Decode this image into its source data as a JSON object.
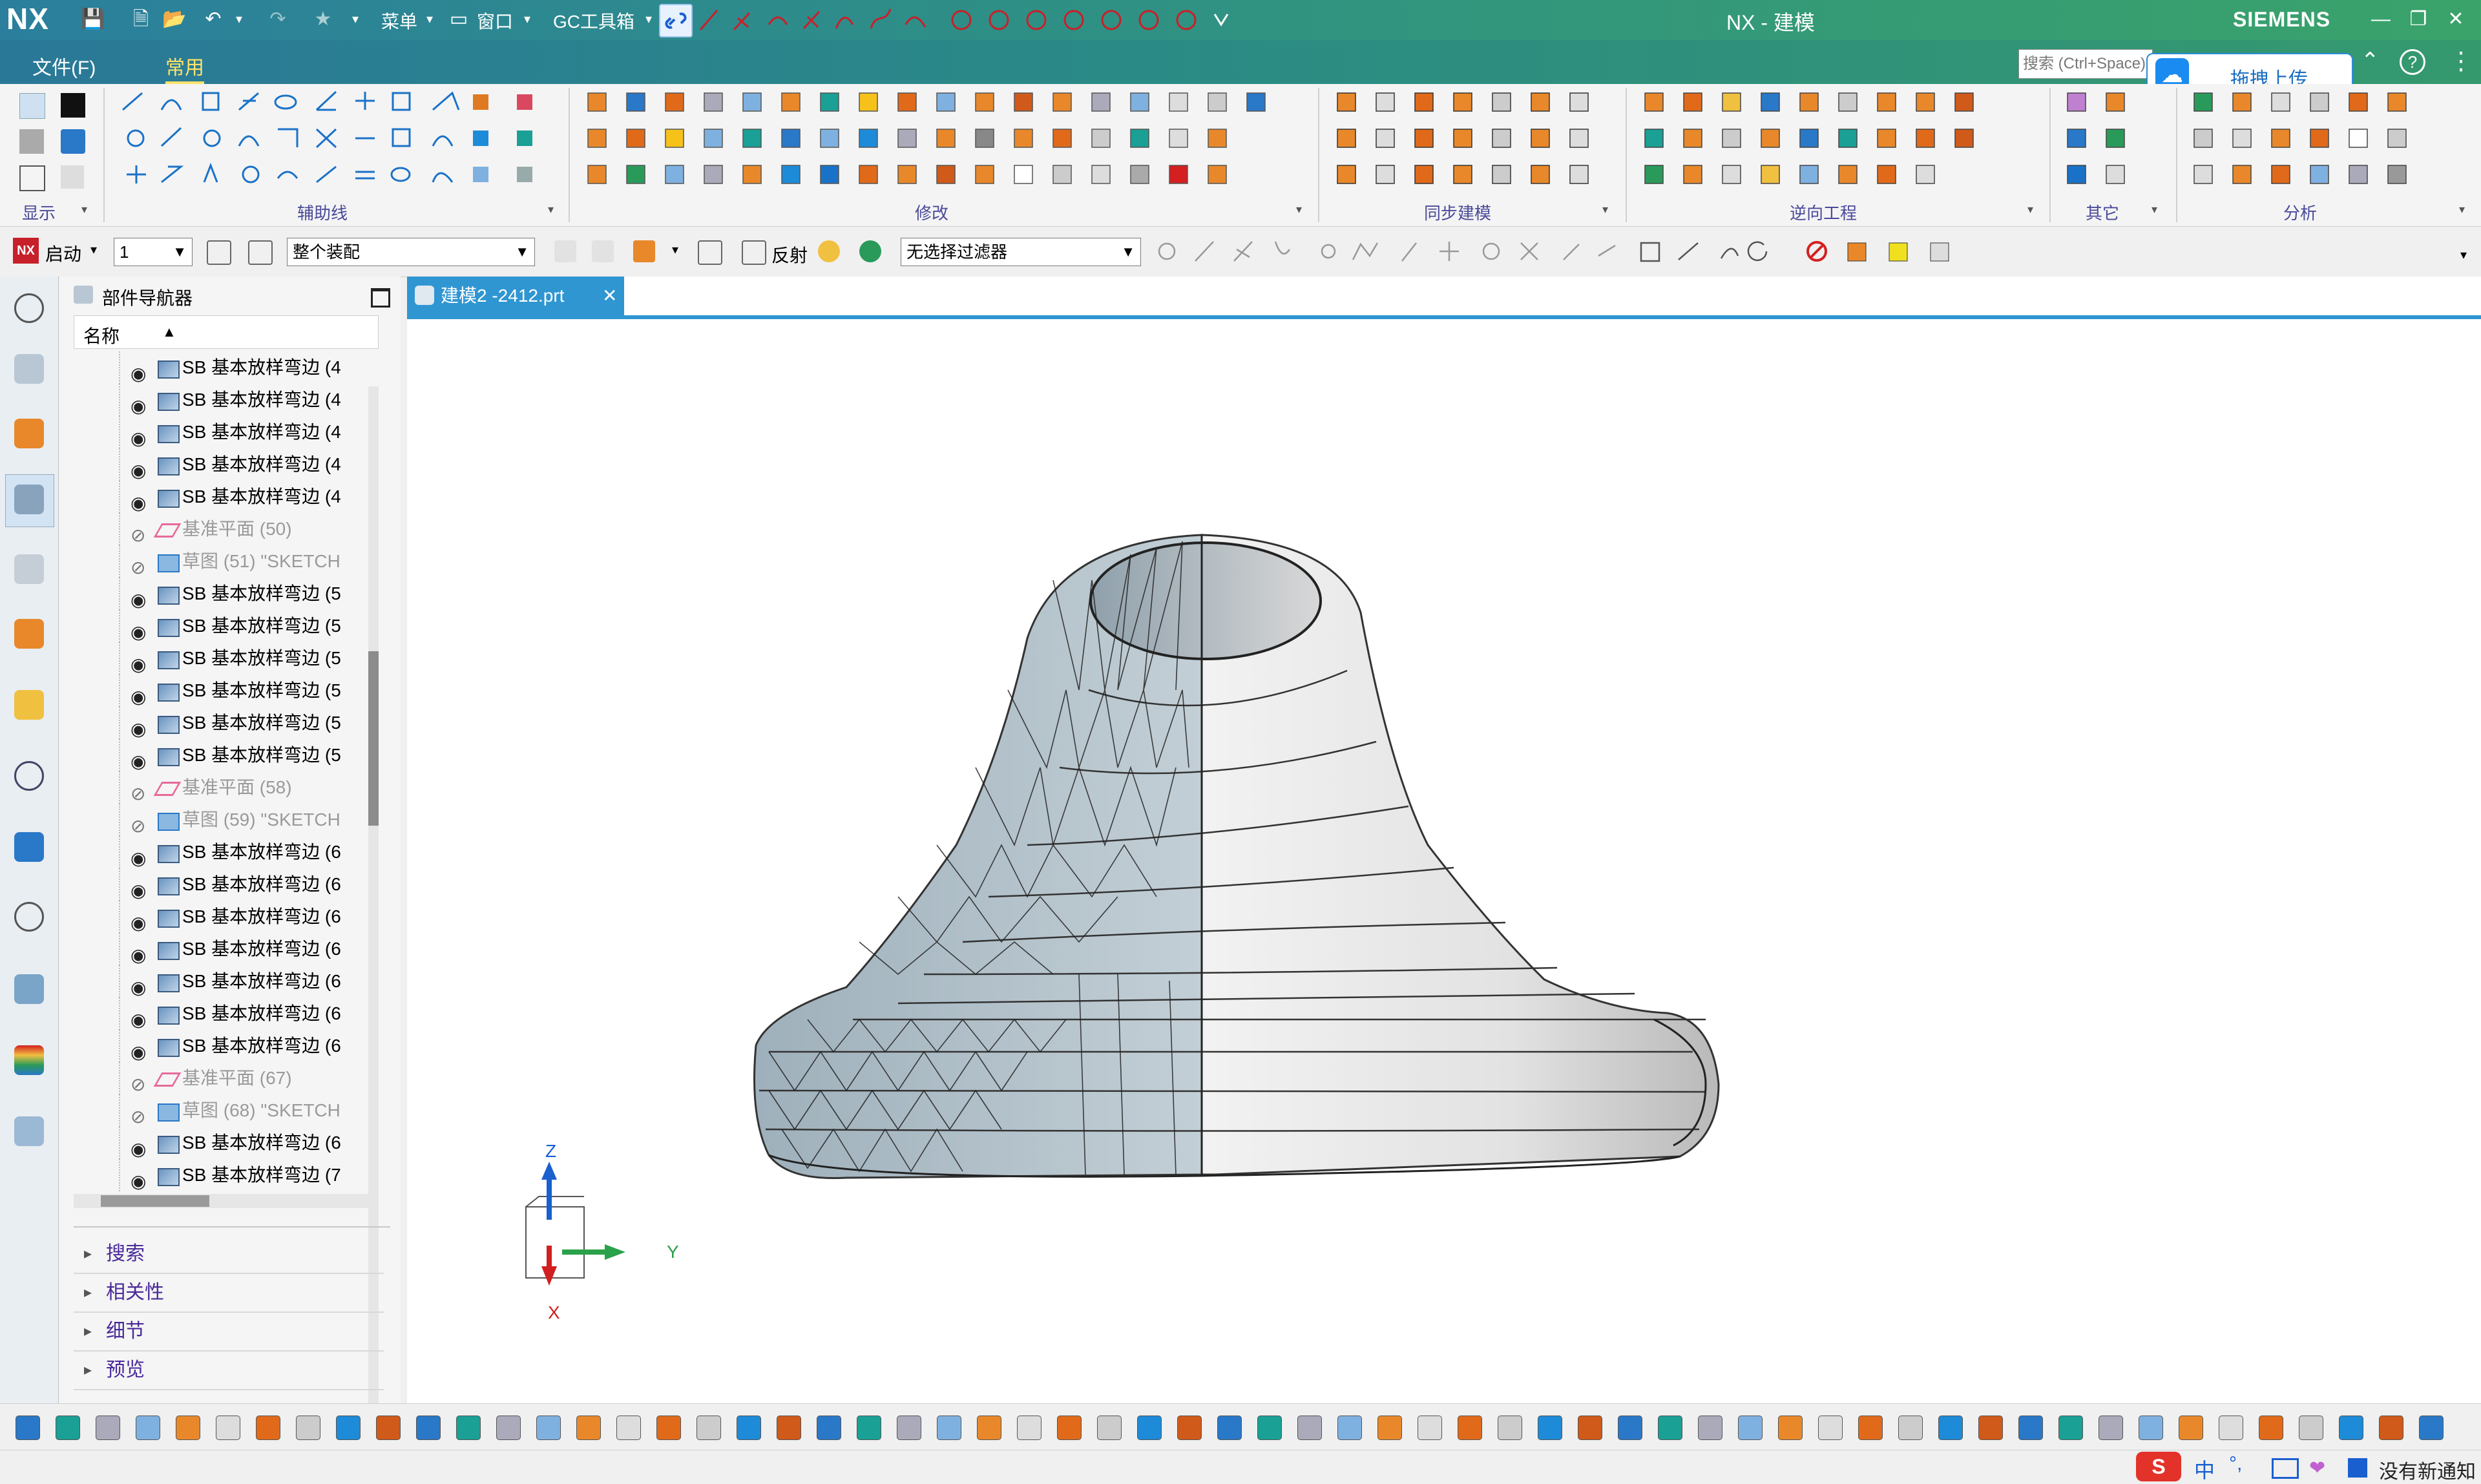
{
  "window": {
    "logo": "NX",
    "title": "NX - 建模",
    "brand": "SIEMENS",
    "quick_access": {
      "menu_label": "菜单",
      "window_label": "窗口",
      "gc_label": "GC工具箱"
    }
  },
  "menu": {
    "file_tab": "文件(F)",
    "home_tab": "常用",
    "search_placeholder": "搜索 (Ctrl+Space)",
    "upload_button": "拖拽上传"
  },
  "ribbon": {
    "groups": [
      "显示",
      "辅助线",
      "修改",
      "同步建模",
      "逆向工程",
      "其它",
      "分析"
    ]
  },
  "selection_bar": {
    "start_label": "启动",
    "layer_value": "1",
    "scope_value": "整个装配",
    "reverse_label": "反射",
    "filter_value": "无选择过滤器"
  },
  "navigator": {
    "title": "部件导航器",
    "column_name": "名称",
    "rows": [
      {
        "label": "SB 基本放样弯边 (4",
        "hidden": false,
        "kind": "flange"
      },
      {
        "label": "SB 基本放样弯边 (4",
        "hidden": false,
        "kind": "flange"
      },
      {
        "label": "SB 基本放样弯边 (4",
        "hidden": false,
        "kind": "flange"
      },
      {
        "label": "SB 基本放样弯边 (4",
        "hidden": false,
        "kind": "flange"
      },
      {
        "label": "SB 基本放样弯边 (4",
        "hidden": false,
        "kind": "flange"
      },
      {
        "label": "基准平面 (50)",
        "hidden": true,
        "kind": "plane"
      },
      {
        "label": "草图 (51) \"SKETCH",
        "hidden": true,
        "kind": "sketch"
      },
      {
        "label": "SB 基本放样弯边 (5",
        "hidden": false,
        "kind": "flange"
      },
      {
        "label": "SB 基本放样弯边 (5",
        "hidden": false,
        "kind": "flange"
      },
      {
        "label": "SB 基本放样弯边 (5",
        "hidden": false,
        "kind": "flange"
      },
      {
        "label": "SB 基本放样弯边 (5",
        "hidden": false,
        "kind": "flange"
      },
      {
        "label": "SB 基本放样弯边 (5",
        "hidden": false,
        "kind": "flange"
      },
      {
        "label": "SB 基本放样弯边 (5",
        "hidden": false,
        "kind": "flange"
      },
      {
        "label": "基准平面 (58)",
        "hidden": true,
        "kind": "plane"
      },
      {
        "label": "草图 (59) \"SKETCH",
        "hidden": true,
        "kind": "sketch"
      },
      {
        "label": "SB 基本放样弯边 (6",
        "hidden": false,
        "kind": "flange"
      },
      {
        "label": "SB 基本放样弯边 (6",
        "hidden": false,
        "kind": "flange"
      },
      {
        "label": "SB 基本放样弯边 (6",
        "hidden": false,
        "kind": "flange"
      },
      {
        "label": "SB 基本放样弯边 (6",
        "hidden": false,
        "kind": "flange"
      },
      {
        "label": "SB 基本放样弯边 (6",
        "hidden": false,
        "kind": "flange"
      },
      {
        "label": "SB 基本放样弯边 (6",
        "hidden": false,
        "kind": "flange"
      },
      {
        "label": "SB 基本放样弯边 (6",
        "hidden": false,
        "kind": "flange"
      },
      {
        "label": "基准平面 (67)",
        "hidden": true,
        "kind": "plane"
      },
      {
        "label": "草图 (68) \"SKETCH",
        "hidden": true,
        "kind": "sketch"
      },
      {
        "label": "SB 基本放样弯边 (6",
        "hidden": false,
        "kind": "flange"
      },
      {
        "label": "SB 基本放样弯边 (7",
        "hidden": false,
        "kind": "flange"
      }
    ],
    "sections": [
      "搜索",
      "相关性",
      "细节",
      "预览"
    ]
  },
  "document_tab": {
    "label": "建模2 -2412.prt"
  },
  "triad": {
    "z": "Z",
    "y": "Y",
    "x": "X"
  },
  "status": {
    "notice": "没有新通知",
    "ime": "中"
  },
  "colors": {
    "accent": "#2f96d1",
    "title_green": "#3aa36a",
    "title_blue": "#2b7f9d",
    "group_label": "#4a4a9a",
    "axis_z": "#1a5fd0",
    "axis_y": "#2aa14a",
    "axis_x": "#d21f1f"
  }
}
